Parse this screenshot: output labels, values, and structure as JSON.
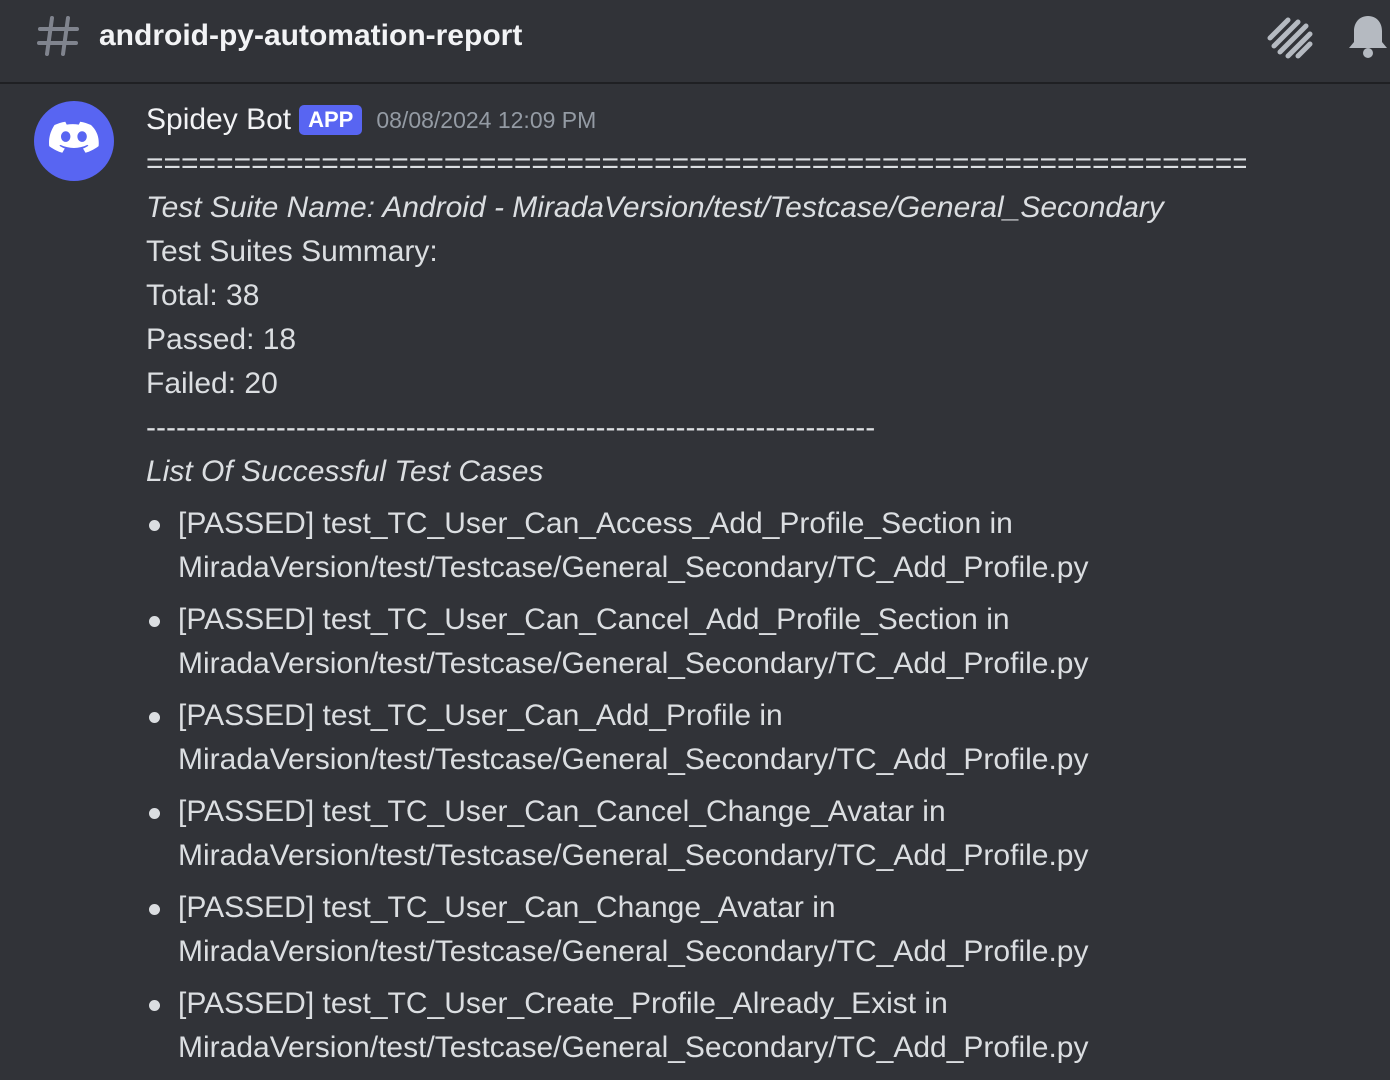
{
  "header": {
    "channel_name": "android-py-automation-report",
    "icons": [
      "hash-icon",
      "threads-icon",
      "bell-icon"
    ]
  },
  "message": {
    "author": "Spidey Bot",
    "badge": "APP",
    "timestamp": "08/08/2024 12:09 PM",
    "avatar_icon": "discord-logo-icon",
    "lines": {
      "separator_eq": "===================================================================",
      "suite_name": "Test Suite Name: Android - MiradaVersion/test/Testcase/General_Secondary",
      "summary_title": "Test Suites Summary:",
      "total": "Total: 38",
      "passed": "Passed: 18",
      "failed": "Failed: 20",
      "separator_dash": "-------------------------------------------------------------------------",
      "list_title": "List Of Successful Test Cases"
    },
    "cases": [
      {
        "line1": "[PASSED] test_TC_User_Can_Access_Add_Profile_Section in",
        "line2": "MiradaVersion/test/Testcase/General_Secondary/TC_Add_Profile.py"
      },
      {
        "line1": "[PASSED] test_TC_User_Can_Cancel_Add_Profile_Section in",
        "line2": "MiradaVersion/test/Testcase/General_Secondary/TC_Add_Profile.py"
      },
      {
        "line1": "[PASSED] test_TC_User_Can_Add_Profile in",
        "line2": "MiradaVersion/test/Testcase/General_Secondary/TC_Add_Profile.py"
      },
      {
        "line1": "[PASSED] test_TC_User_Can_Cancel_Change_Avatar in",
        "line2": "MiradaVersion/test/Testcase/General_Secondary/TC_Add_Profile.py"
      },
      {
        "line1": "[PASSED] test_TC_User_Can_Change_Avatar in",
        "line2": "MiradaVersion/test/Testcase/General_Secondary/TC_Add_Profile.py"
      },
      {
        "line1": "[PASSED] test_TC_User_Create_Profile_Already_Exist in",
        "line2": "MiradaVersion/test/Testcase/General_Secondary/TC_Add_Profile.py"
      }
    ]
  },
  "colors": {
    "background": "#313338",
    "badge": "#5865f2",
    "avatar": "#5865f2",
    "text": "#dbdee1",
    "muted": "#949ba4"
  }
}
